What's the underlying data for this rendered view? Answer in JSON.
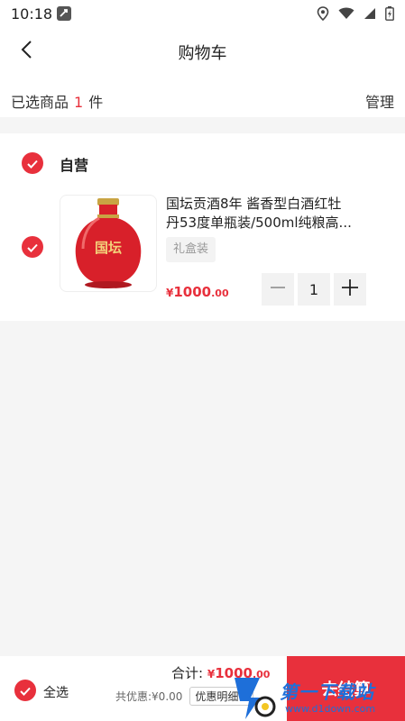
{
  "status_bar": {
    "time": "10:18",
    "icons": [
      "app-notification-icon",
      "location-icon",
      "wifi-icon",
      "signal-icon",
      "battery-icon"
    ]
  },
  "header": {
    "title": "购物车",
    "back_icon": "chevron-left-icon"
  },
  "summary": {
    "prefix": "已选商品",
    "count": "1",
    "suffix": "件",
    "manage_label": "管理"
  },
  "shop": {
    "name": "自营",
    "checked": true,
    "items": [
      {
        "title_line1": "国坛贡酒8年 酱香型白酒红牡",
        "title_line2": "丹53度单瓶装/500ml纯粮高...",
        "spec": "礼盒装",
        "price_symbol": "¥",
        "price_int": "1000",
        "price_dec": ".00",
        "quantity": "1",
        "checked": true,
        "image_logo_text": "国坛"
      }
    ]
  },
  "footer": {
    "select_all_label": "全选",
    "total_label": "合计:",
    "total_symbol": "¥",
    "total_int": "1000",
    "total_dec": ".00",
    "discount_label": "共优惠:¥0.00",
    "discount_detail_label": "优惠明细",
    "checkout_label": "去结算"
  },
  "watermark": {
    "text": "第一下载站",
    "url": "www.d1down.com"
  },
  "colors": {
    "accent": "#e8303c",
    "background": "#f5f5f5",
    "card": "#ffffff"
  }
}
